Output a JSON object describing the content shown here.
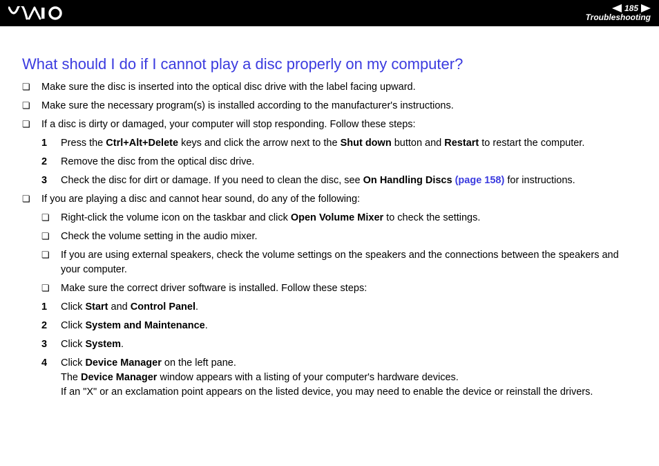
{
  "header": {
    "page_number": "185",
    "section": "Troubleshooting"
  },
  "title": "What should I do if I cannot play a disc properly on my computer?",
  "bullets": {
    "b1": "Make sure the disc is inserted into the optical disc drive with the label facing upward.",
    "b2": "Make sure the necessary program(s) is installed according to the manufacturer's instructions.",
    "b3": "If a disc is dirty or damaged, your computer will stop responding. Follow these steps:",
    "b4": "If you are playing a disc and cannot hear sound, do any of the following:"
  },
  "steps_a": {
    "s1_pre": "Press the ",
    "s1_b1": "Ctrl+Alt+Delete",
    "s1_mid1": " keys and click the arrow next to the ",
    "s1_b2": "Shut down",
    "s1_mid2": " button and ",
    "s1_b3": "Restart",
    "s1_post": " to restart the computer.",
    "s2": "Remove the disc from the optical disc drive.",
    "s3_pre": "Check the disc for dirt or damage. If you need to clean the disc, see ",
    "s3_b": "On Handling Discs",
    "s3_link": " (page 158)",
    "s3_post": " for instructions."
  },
  "sound": {
    "sb1_pre": "Right-click the volume icon on the taskbar and click ",
    "sb1_b": "Open Volume Mixer",
    "sb1_post": " to check the settings.",
    "sb2": "Check the volume setting in the audio mixer.",
    "sb3": "If you are using external speakers, check the volume settings on the speakers and the connections between the speakers and your computer.",
    "sb4": "Make sure the correct driver software is installed. Follow these steps:"
  },
  "steps_b": {
    "s1_pre": "Click ",
    "s1_b1": "Start",
    "s1_mid": " and ",
    "s1_b2": "Control Panel",
    "s1_post": ".",
    "s2_pre": "Click ",
    "s2_b": "System and Maintenance",
    "s2_post": ".",
    "s3_pre": "Click ",
    "s3_b": "System",
    "s3_post": ".",
    "s4_pre": "Click ",
    "s4_b1": "Device Manager",
    "s4_mid1": " on the left pane.",
    "s4_line2_pre": "The ",
    "s4_line2_b": "Device Manager",
    "s4_line2_post": " window appears with a listing of your computer's hardware devices.",
    "s4_line3": "If an \"X\" or an exclamation point appears on the listed device, you may need to enable the device or reinstall the drivers."
  },
  "markers": {
    "n1": "1",
    "n2": "2",
    "n3": "3",
    "n4": "4"
  }
}
